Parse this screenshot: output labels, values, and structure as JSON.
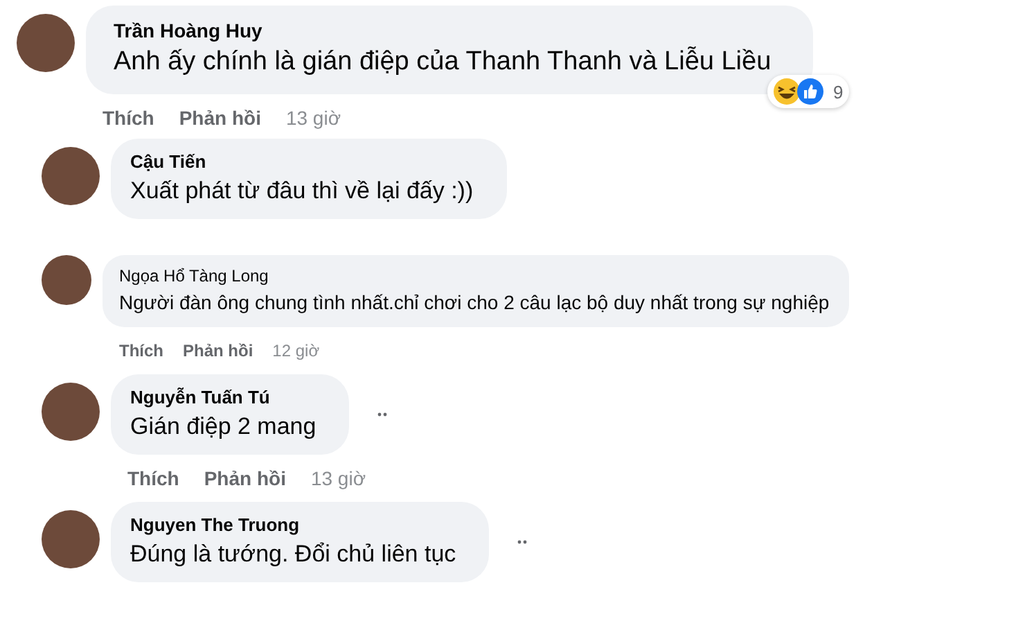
{
  "comments": [
    {
      "author": "Trần Hoàng Huy",
      "text": "Anh ấy chính là gián điệp của Thanh Thanh và Liễu Liều",
      "kind": "large",
      "actions": [
        "Thích",
        "Phản hồi"
      ],
      "time": "13 giờ",
      "reactions": {
        "count": "9"
      },
      "more": false,
      "children": [
        {
          "author": "Cậu Tiến",
          "text": "Xuất phát từ đâu thì về lại đấy :))",
          "kind": "medium",
          "more": false
        },
        {
          "author": "Ngọa Hổ Tàng Long",
          "text": "Người đàn ông chung tình nhất.chỉ chơi cho 2 câu lạc bộ duy nhất trong sự nghiệp",
          "kind": "small",
          "actions": [
            "Thích",
            "Phản hồi"
          ],
          "time": "12 giờ",
          "more": false
        },
        {
          "author": "Nguyễn Tuấn Tú",
          "text": "Gián điệp 2 mang",
          "kind": "medium",
          "actions": [
            "Thích",
            "Phản hồi"
          ],
          "time": "13 giờ",
          "more": true
        },
        {
          "author": "Nguyen The Truong",
          "text": "Đúng là tướng. Đổi chủ liên tục",
          "kind": "medium",
          "more": true
        }
      ]
    }
  ]
}
